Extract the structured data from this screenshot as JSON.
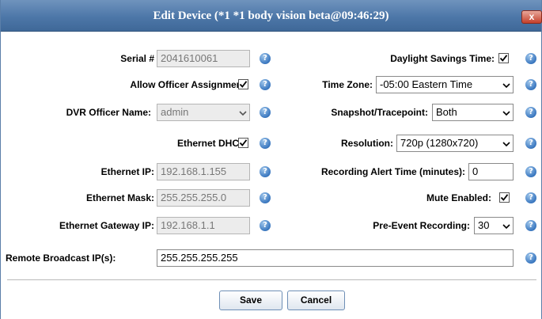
{
  "dialog": {
    "title": "Edit Device (*1 *1 body vision beta@09:46:29)",
    "close_label": "x"
  },
  "help_glyph": "?",
  "left": {
    "serial_label": "Serial #",
    "serial_value": "2041610061",
    "allow_officer_label": "Allow Officer Assignment:",
    "allow_officer_checked": true,
    "dvr_officer_label": "DVR Officer Name:",
    "dvr_officer_value": "admin",
    "ethernet_dhcp_label": "Ethernet DHCP:",
    "ethernet_dhcp_checked": true,
    "ethernet_ip_label": "Ethernet IP:",
    "ethernet_ip_value": "192.168.1.155",
    "ethernet_mask_label": "Ethernet Mask:",
    "ethernet_mask_value": "255.255.255.0",
    "ethernet_gateway_label": "Ethernet Gateway IP:",
    "ethernet_gateway_value": "192.168.1.1"
  },
  "right": {
    "dst_label": "Daylight Savings Time:",
    "dst_checked": true,
    "timezone_label": "Time Zone:",
    "timezone_value": "-05:00 Eastern Time",
    "snapshot_label": "Snapshot/Tracepoint:",
    "snapshot_value": "Both",
    "resolution_label": "Resolution:",
    "resolution_value": "720p (1280x720)",
    "recording_alert_label": "Recording Alert Time (minutes):",
    "recording_alert_value": "0",
    "mute_label": "Mute Enabled:",
    "mute_checked": true,
    "pre_event_label": "Pre-Event Recording:",
    "pre_event_value": "30"
  },
  "remote": {
    "label": "Remote Broadcast IP(s):",
    "value": "255.255.255.255"
  },
  "buttons": {
    "save": "Save",
    "cancel": "Cancel"
  },
  "colors": {
    "titlebar": "#4d77a8",
    "help_icon": "#3b78c0",
    "close_button": "#c5402b"
  }
}
